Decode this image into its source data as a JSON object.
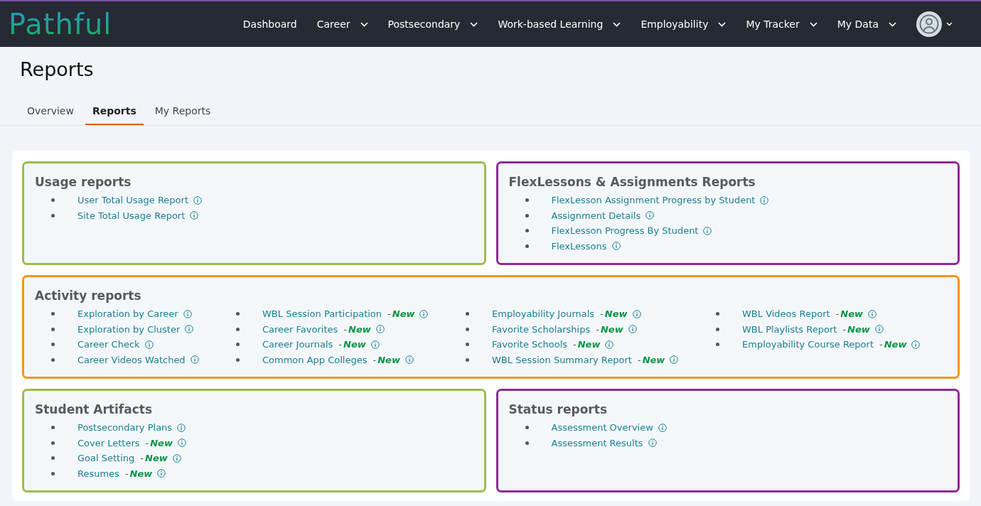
{
  "navbar": {
    "logo": "Pathful",
    "items": [
      {
        "label": "Dashboard",
        "has_menu": false
      },
      {
        "label": "Career",
        "has_menu": true
      },
      {
        "label": "Postsecondary",
        "has_menu": true
      },
      {
        "label": "Work-based Learning",
        "has_menu": true
      },
      {
        "label": "Employability",
        "has_menu": true
      },
      {
        "label": "My Tracker",
        "has_menu": true
      },
      {
        "label": "My Data",
        "has_menu": true
      }
    ]
  },
  "page_title": "Reports",
  "tabs": [
    {
      "label": "Overview",
      "selected": false
    },
    {
      "label": "Reports",
      "selected": true
    },
    {
      "label": "My Reports",
      "selected": false
    }
  ],
  "sections": [
    {
      "title": "Usage reports",
      "color": "#9cbc4c",
      "kind": "half",
      "columns": [
        [
          {
            "label": "User Total Usage Report"
          },
          {
            "label": "Site Total Usage Report"
          }
        ]
      ]
    },
    {
      "title": "FlexLessons & Assignments Reports",
      "color": "#8e2b91",
      "kind": "half",
      "columns": [
        [
          {
            "label": "FlexLesson Assignment Progress by Student"
          },
          {
            "label": "Assignment Details"
          },
          {
            "label": "FlexLesson Progress By Student"
          },
          {
            "label": "FlexLessons"
          }
        ]
      ]
    },
    {
      "title": "Activity reports",
      "color": "#f7941d",
      "kind": "full",
      "columns": [
        [
          {
            "label": "Exploration by Career"
          },
          {
            "label": "Exploration by Cluster"
          },
          {
            "label": "Career Check"
          },
          {
            "label": "Career Videos Watched"
          }
        ],
        [
          {
            "label": "WBL Session Participation",
            "separator": "-",
            "badge": "New"
          },
          {
            "label": "Career Favorites",
            "separator": "-",
            "badge": "New"
          },
          {
            "label": "Career Journals",
            "separator": "-",
            "badge": "New"
          },
          {
            "label": "Common App Colleges",
            "separator": "-",
            "badge": "New"
          }
        ],
        [
          {
            "label": "Employability Journals",
            "separator": "-",
            "badge": "New"
          },
          {
            "label": "Favorite Scholarships",
            "separator": "-",
            "badge": "New"
          },
          {
            "label": "Favorite Schools",
            "separator": "-",
            "badge": "New"
          },
          {
            "label": "WBL Session Summary Report",
            "separator": "-",
            "badge": "New"
          }
        ],
        [
          {
            "label": "WBL Videos Report",
            "separator": "-",
            "badge": "New"
          },
          {
            "label": "WBL Playlists Report",
            "separator": "-",
            "badge": "New"
          },
          {
            "label": "Employability Course Report",
            "separator": "-",
            "badge": "New"
          }
        ]
      ]
    },
    {
      "title": "Student Artifacts",
      "color": "#9cbc4c",
      "kind": "half",
      "columns": [
        [
          {
            "label": "Postsecondary Plans"
          },
          {
            "label": "Cover Letters",
            "separator": "-",
            "badge": "New"
          },
          {
            "label": "Goal Setting",
            "separator": "-",
            "badge": "New"
          },
          {
            "label": "Resumes",
            "separator": "-",
            "badge": "New"
          }
        ]
      ]
    },
    {
      "title": "Status reports",
      "color": "#8e2b91",
      "kind": "half",
      "columns": [
        [
          {
            "label": "Assessment Overview"
          },
          {
            "label": "Assessment Results"
          }
        ]
      ]
    }
  ]
}
